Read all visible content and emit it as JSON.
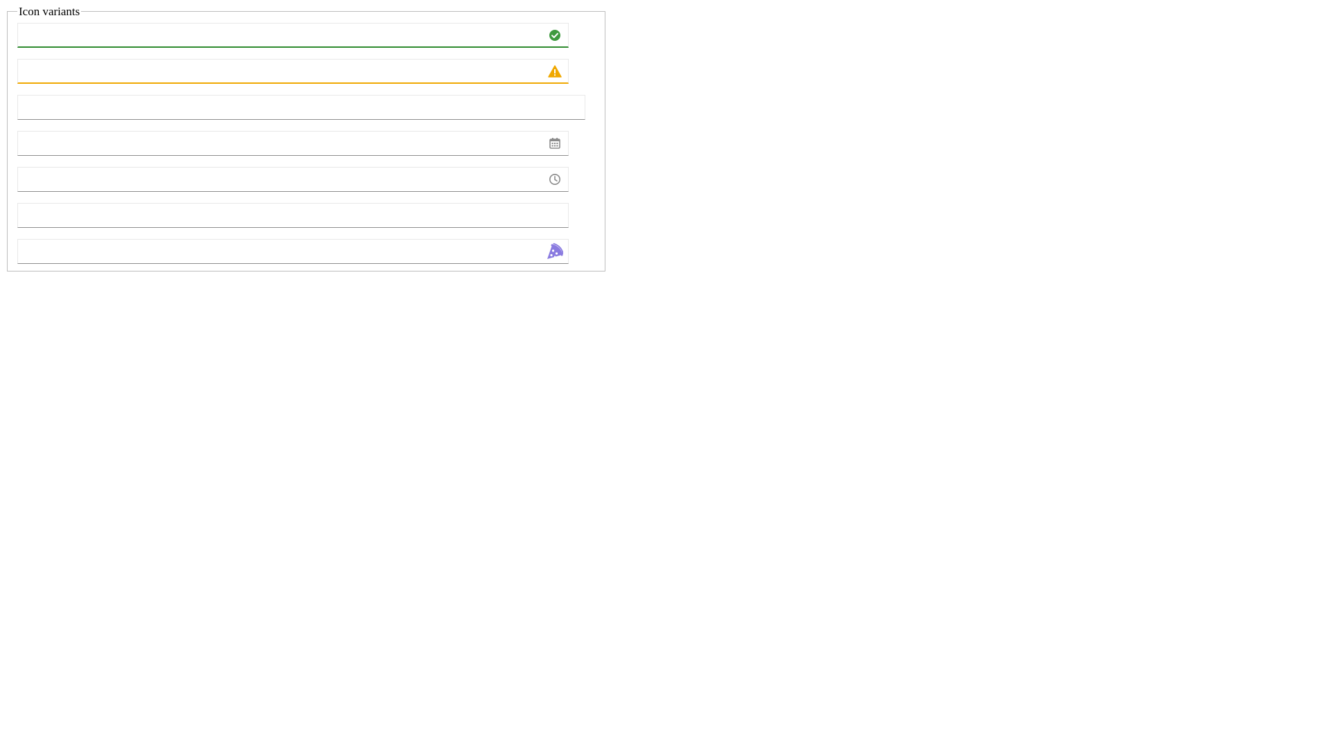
{
  "fieldset": {
    "legend": "Icon variants"
  },
  "fields": [
    {
      "name": "success-field",
      "value": "",
      "placeholder": "",
      "state": "success",
      "icon": "check-circle-icon",
      "icon_color": "#3f9a3f"
    },
    {
      "name": "warning-field",
      "value": "",
      "placeholder": "",
      "state": "warning",
      "icon": "warning-triangle-icon",
      "icon_color": "#f0a800"
    },
    {
      "name": "plain-field-wide",
      "value": "",
      "placeholder": "",
      "state": "default",
      "icon": null
    },
    {
      "name": "date-field",
      "value": "",
      "placeholder": "",
      "state": "default",
      "icon": "calendar-icon",
      "icon_color": "#8a8a8a"
    },
    {
      "name": "time-field",
      "value": "",
      "placeholder": "",
      "state": "default",
      "icon": "clock-icon",
      "icon_color": "#8a8a8a"
    },
    {
      "name": "plain-field",
      "value": "",
      "placeholder": "",
      "state": "default",
      "icon": null
    },
    {
      "name": "custom-icon-field",
      "value": "",
      "placeholder": "",
      "state": "default",
      "icon": "pizza-icon",
      "icon_color": "#8a7be0"
    }
  ],
  "colors": {
    "success": "#2e8b2e",
    "warning": "#f0a800",
    "default_underline": "#8d8d8d",
    "neutral_icon": "#8a8a8a",
    "custom_icon": "#8a7be0"
  }
}
